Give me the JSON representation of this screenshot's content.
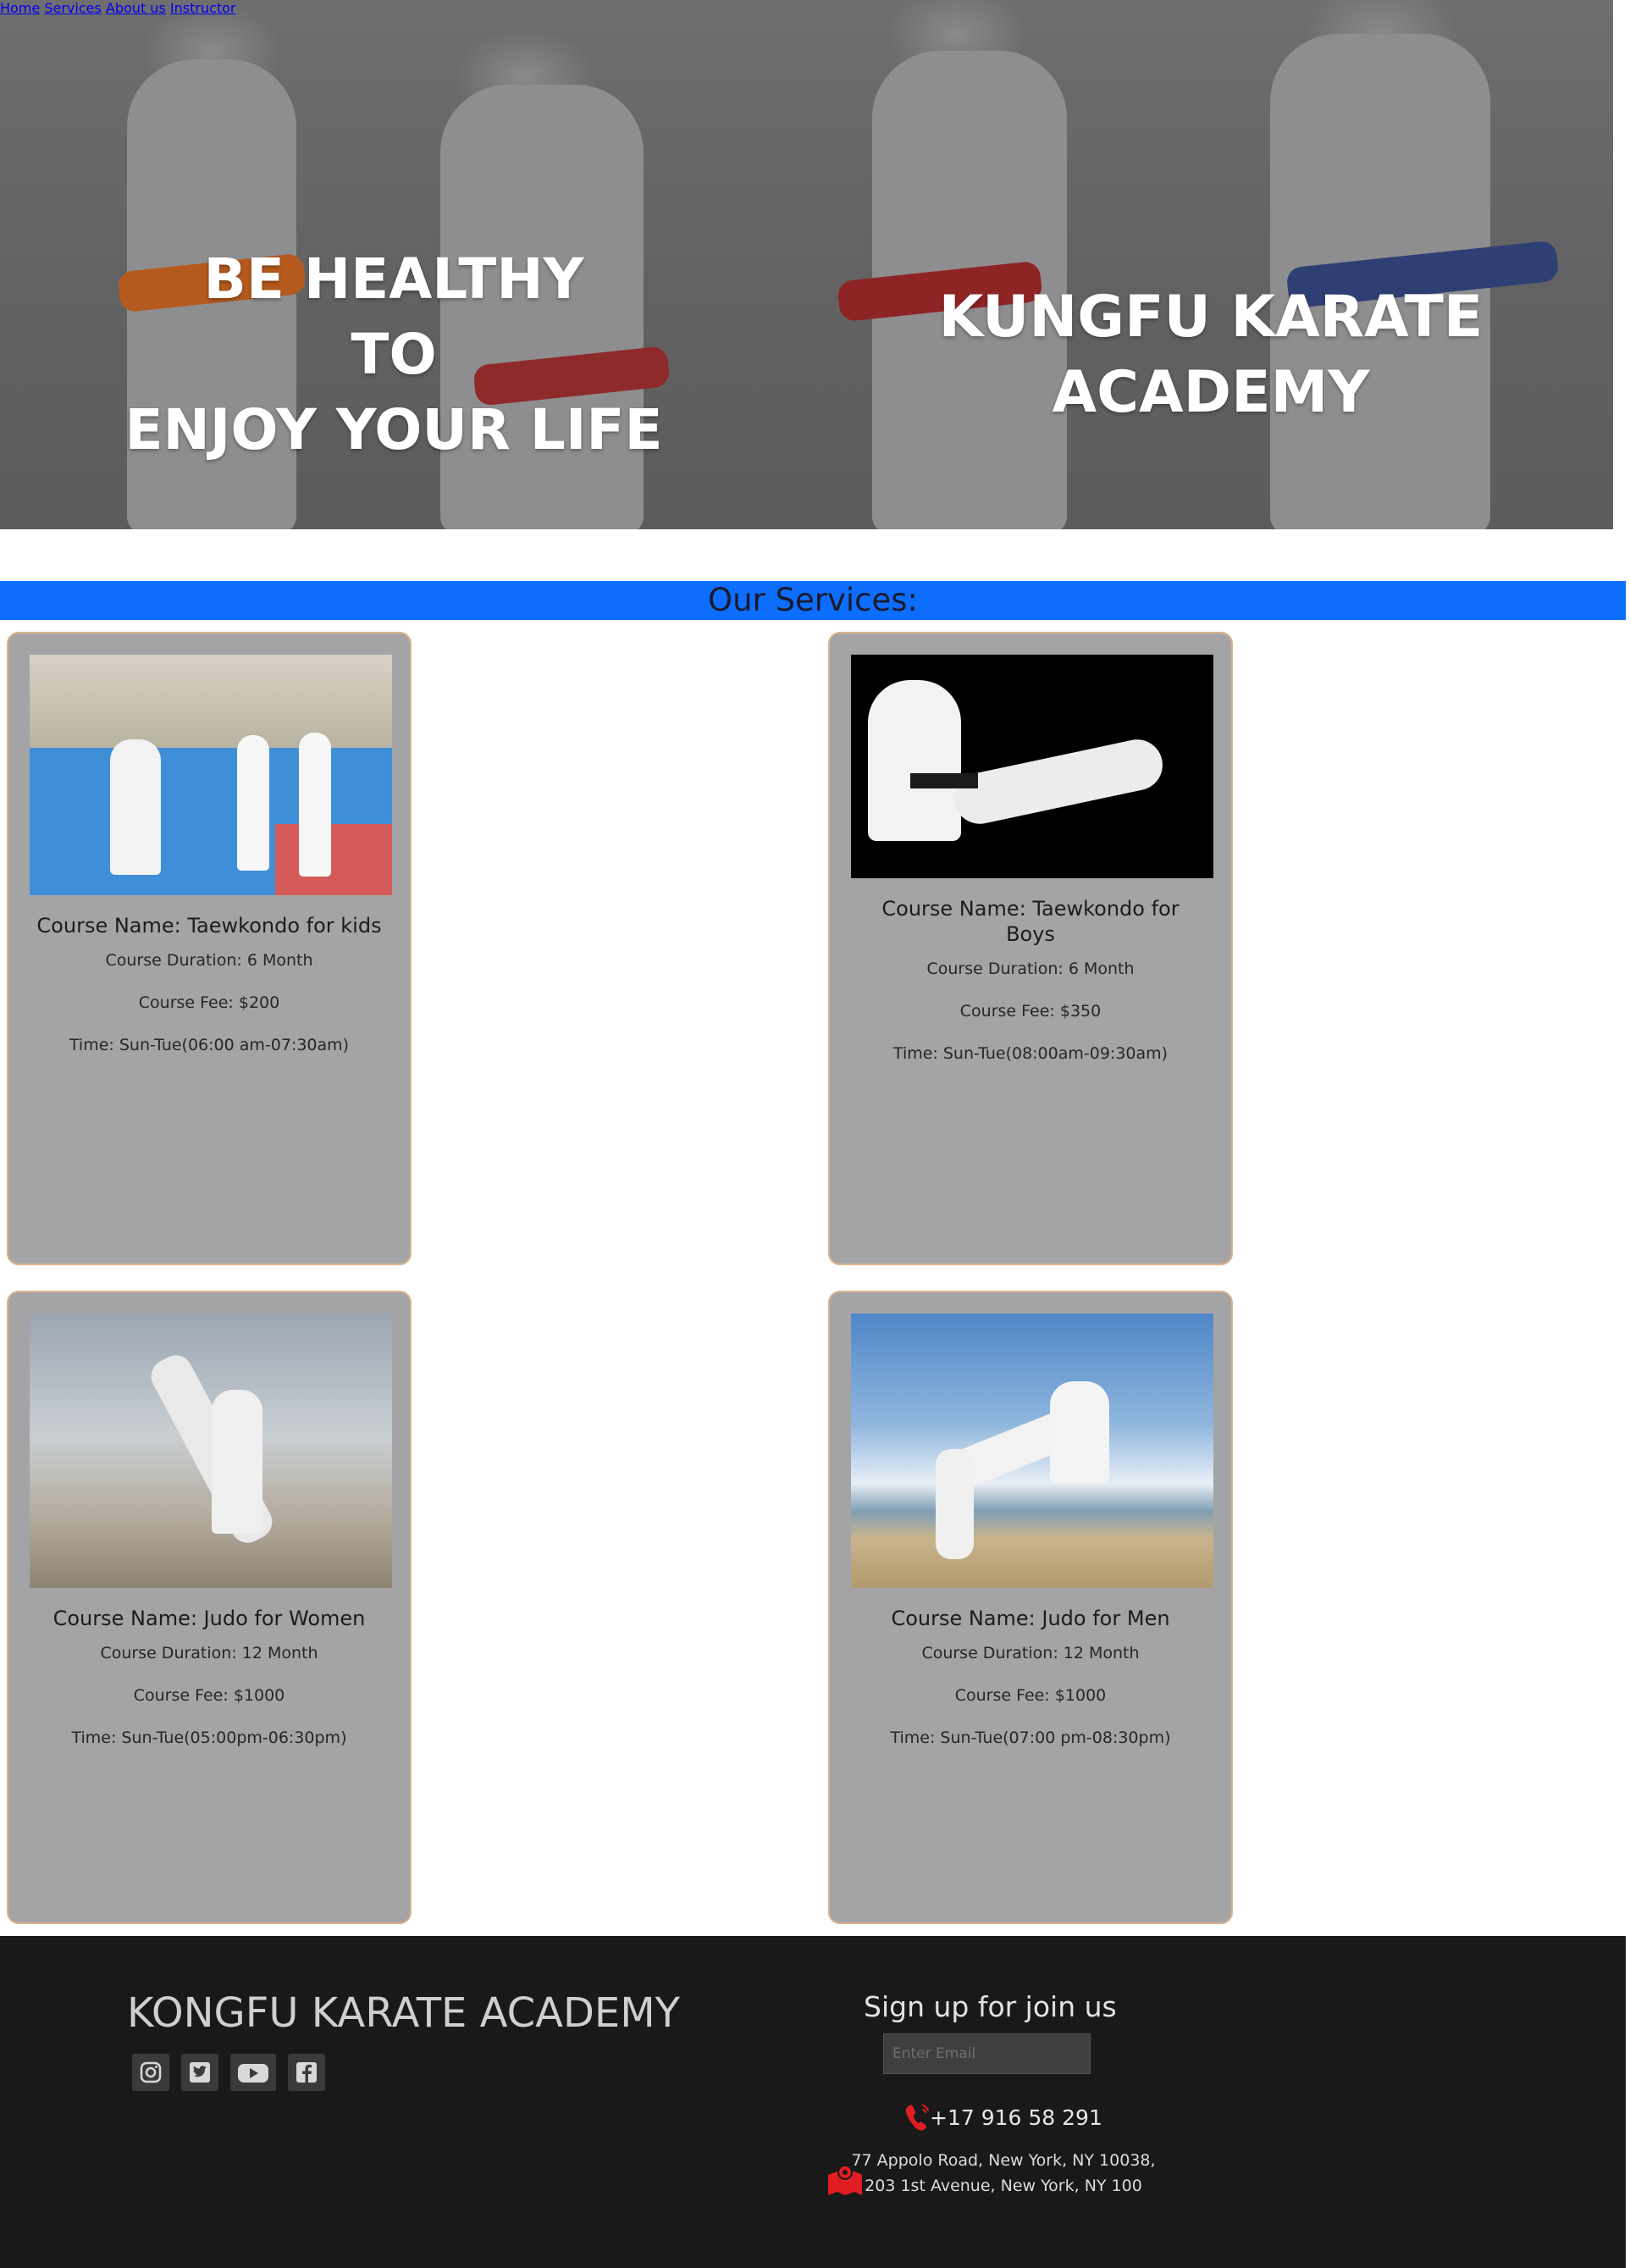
{
  "nav": {
    "items": [
      {
        "label": "Home"
      },
      {
        "label": "Services"
      },
      {
        "label": "About us"
      },
      {
        "label": "Instructor"
      }
    ]
  },
  "hero": {
    "left_lines": [
      "BE HEALTHY",
      "TO",
      "ENJOY YOUR LIFE"
    ],
    "right_lines": [
      "KUNGFU KARATE",
      "ACADEMY"
    ]
  },
  "services": {
    "heading": "Our Services:",
    "cards": [
      {
        "name": "Course Name: Taewkondo for kids",
        "duration": "Course Duration: 6 Month",
        "fee": "Course Fee: $200",
        "time": "Time: Sun-Tue(06:00 am-07:30am)"
      },
      {
        "name": "Course Name: Taewkondo for Boys",
        "duration": "Course Duration: 6 Month",
        "fee": "Course Fee: $350",
        "time": "Time: Sun-Tue(08:00am-09:30am)"
      },
      {
        "name": "Course Name: Judo for Women",
        "duration": "Course Duration: 12 Month",
        "fee": "Course Fee: $1000",
        "time": "Time: Sun-Tue(05:00pm-06:30pm)"
      },
      {
        "name": "Course Name: Judo for Men",
        "duration": "Course Duration: 12 Month",
        "fee": "Course Fee: $1000",
        "time": "Time: Sun-Tue(07:00 pm-08:30pm)"
      }
    ]
  },
  "footer": {
    "brand": "KONGFU KARATE ACADEMY",
    "social_icons": [
      "instagram-icon",
      "twitter-icon",
      "youtube-icon",
      "facebook-icon"
    ],
    "signup_title": "Sign up for join us",
    "email_placeholder": "Enter Email",
    "phone": "+17 916 58 291",
    "address_line1": "77 Appolo Road, New York, NY 10038,",
    "address_line2": "203 1st Avenue, New York, NY 100"
  },
  "colors": {
    "services_bar": "#0d6efd",
    "card_bg": "#a4a4a6",
    "card_border": "#d9b48c",
    "footer_bg": "#19191a",
    "icon_accent": "#e11d24"
  }
}
